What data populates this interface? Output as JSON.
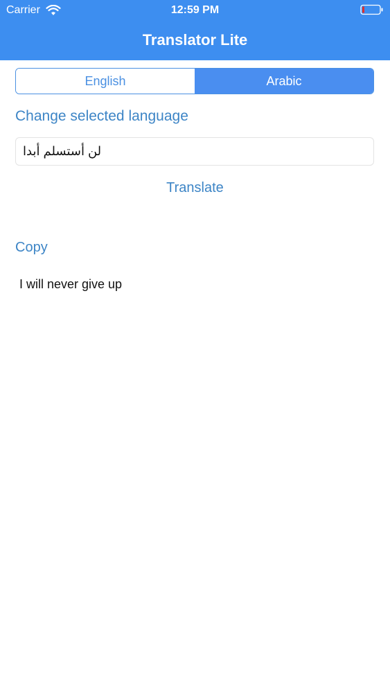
{
  "status_bar": {
    "carrier": "Carrier",
    "time": "12:59 PM",
    "wifi_icon": "wifi-icon",
    "battery_icon": "battery-low-icon"
  },
  "header": {
    "title": "Translator Lite",
    "color": "#3d8ef0"
  },
  "language_selector": {
    "segments": [
      "English",
      "Arabic"
    ],
    "selected": "Arabic",
    "accent_color": "#4a90e2"
  },
  "change_language_label": "Change selected language",
  "input": {
    "value": "لن أستسلم أبدا"
  },
  "translate_label": "Translate",
  "copy_label": "Copy",
  "result_text": "I will never give up"
}
